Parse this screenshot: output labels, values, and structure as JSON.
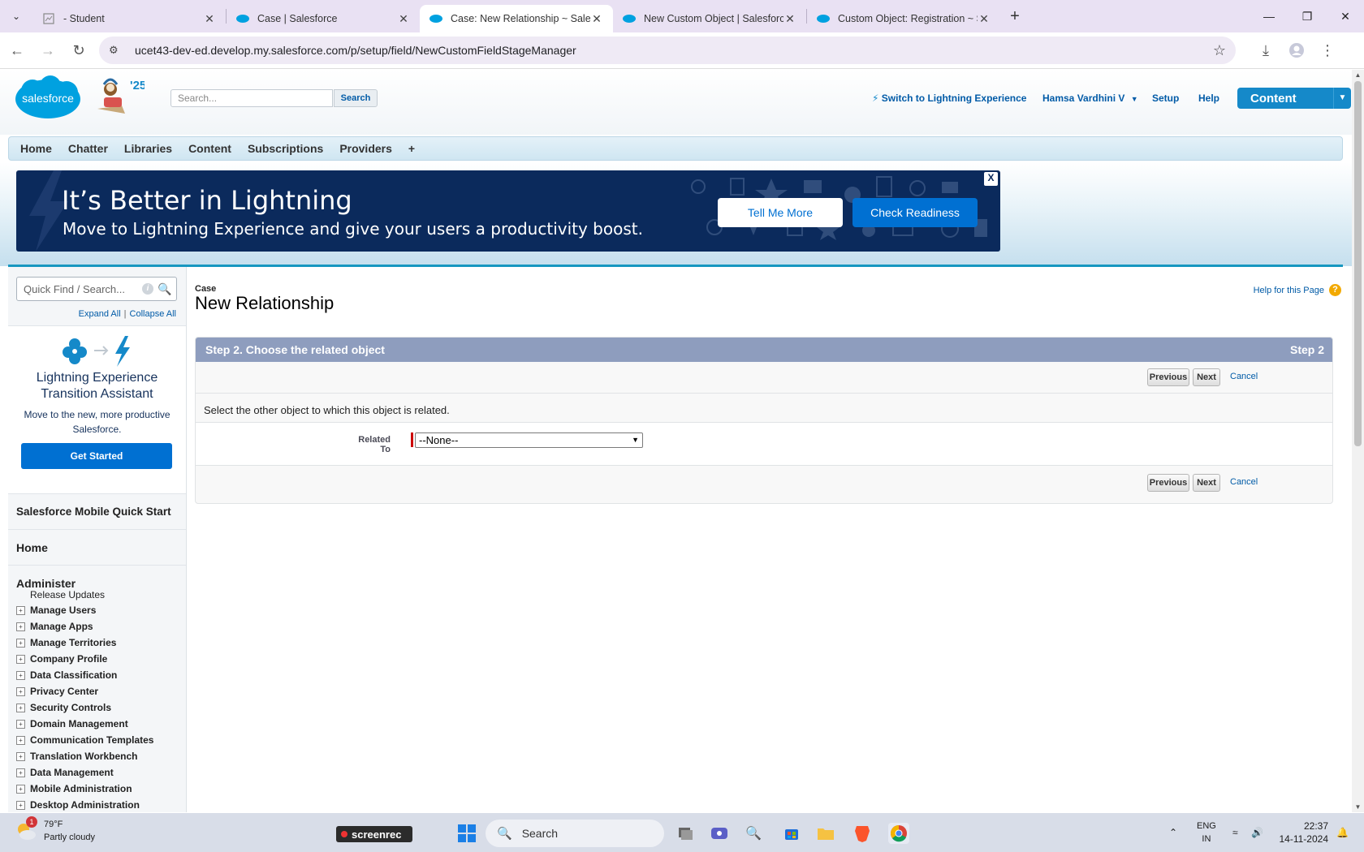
{
  "browser": {
    "tabs": [
      {
        "title": "- Student",
        "active": false
      },
      {
        "title": "Case | Salesforce",
        "active": false
      },
      {
        "title": "Case: New Relationship ~ Salesf",
        "active": true
      },
      {
        "title": "New Custom Object | Salesforce",
        "active": false
      },
      {
        "title": "Custom Object: Registration ~ S",
        "active": false
      }
    ],
    "url": "ucet43-dev-ed.develop.my.salesforce.com/p/setup/field/NewCustomFieldStageManager"
  },
  "header": {
    "logo_text": "salesforce",
    "release_badge": "'25",
    "search_placeholder": "Search...",
    "search_button": "Search",
    "switch_lightning": "Switch to Lightning Experience",
    "user_name": "Hamsa Vardhini V",
    "setup": "Setup",
    "help": "Help",
    "app_menu": "Content"
  },
  "tabs": [
    "Home",
    "Chatter",
    "Libraries",
    "Content",
    "Subscriptions",
    "Providers",
    "+"
  ],
  "banner": {
    "title": "It’s Better in Lightning",
    "subtitle": "Move to Lightning Experience and give your users a productivity boost.",
    "tell_me_more": "Tell Me More",
    "check_readiness": "Check Readiness",
    "close": "X"
  },
  "sidebar": {
    "quick_find_placeholder": "Quick Find / Search...",
    "expand_all": "Expand All",
    "collapse_all": "Collapse All",
    "lta_title": "Lightning Experience Transition Assistant",
    "lta_sub": "Move to the new, more productive Salesforce.",
    "get_started": "Get Started",
    "mobile_quick_start": "Salesforce Mobile Quick Start",
    "home": "Home",
    "administer": "Administer",
    "release_updates": "Release Updates",
    "items": [
      "Manage Users",
      "Manage Apps",
      "Manage Territories",
      "Company Profile",
      "Data Classification",
      "Privacy Center",
      "Security Controls",
      "Domain Management",
      "Communication Templates",
      "Translation Workbench",
      "Data Management",
      "Mobile Administration",
      "Desktop Administration"
    ]
  },
  "main": {
    "breadcrumb": "Case",
    "title": "New Relationship",
    "help_link": "Help for this Page",
    "step_title": "Step 2. Choose the related object",
    "step_label": "Step 2",
    "previous": "Previous",
    "next": "Next",
    "cancel": "Cancel",
    "description": "Select the other object to which this object is related.",
    "related_to_label": "Related To",
    "related_to_value": "--None--"
  },
  "taskbar": {
    "temp": "79°F",
    "weather": "Partly cloudy",
    "weather_badge": "1",
    "screenrec": "screenrec",
    "search": "Search",
    "lang_top": "ENG",
    "lang_bottom": "IN",
    "time": "22:37",
    "date": "14-11-2024"
  }
}
